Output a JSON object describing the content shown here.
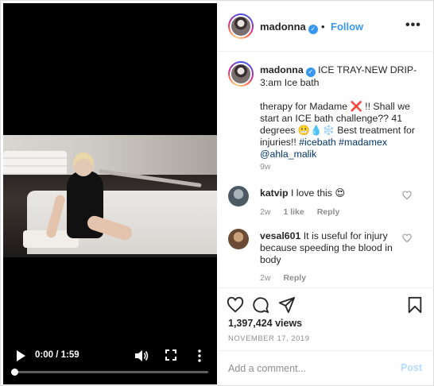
{
  "video": {
    "time": "0:00 / 1:59",
    "progress": 0,
    "icons": {
      "play": "play-icon",
      "volume": "volume-icon",
      "fullscreen": "fullscreen-icon",
      "more": "more-vertical-icon"
    }
  },
  "header": {
    "username": "madonna",
    "separator": "•",
    "follow_label": "Follow",
    "more_label": "•••"
  },
  "caption": {
    "username": "madonna",
    "line1": "ICE TRAY-NEW DRIP-3:am Ice bath",
    "body": "therapy for Madame ❌ !! Shall we start an ICE bath challenge?? 41 degrees 😬💧❄️ Best treatment for injuries!! ",
    "hashtag1": "#icebath",
    "hashtag2": "#madamex",
    "mention": "@ahla_malik",
    "time": "9w"
  },
  "comments": [
    {
      "username": "katvip",
      "text": "I love this 😍",
      "time": "2w",
      "likes": "1 like",
      "reply_label": "Reply"
    },
    {
      "username": "vesal601",
      "text": "It is useful for injury because speeding the blood in body",
      "time": "2w",
      "likes": "",
      "reply_label": "Reply"
    }
  ],
  "stats": {
    "views": "1,397,424 views",
    "date": "NOVEMBER 17, 2019"
  },
  "add_comment": {
    "placeholder": "Add a comment...",
    "post_label": "Post"
  },
  "colors": {
    "accent": "#3897f0",
    "post_disabled": "#b3dbff",
    "hashtag": "#003569",
    "muted": "#8e8e8e"
  }
}
